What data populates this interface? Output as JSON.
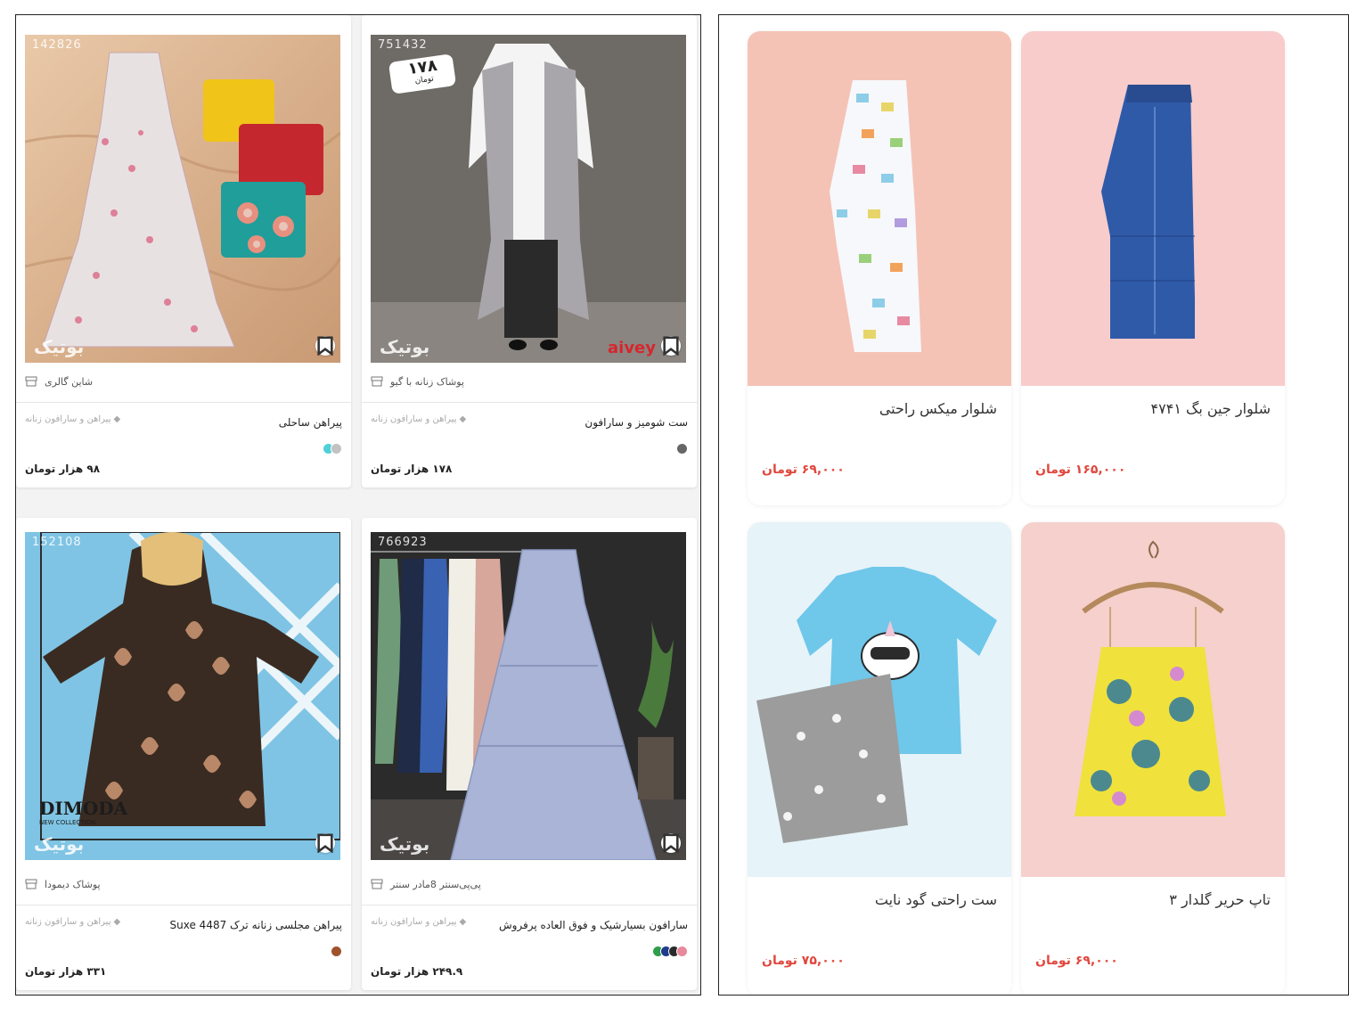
{
  "left_grid": {
    "cards": [
      {
        "code": "142826",
        "watermark": "بوتیک",
        "shop": "شاین گالری",
        "title": "پیراهن ساحلی",
        "category": "پیراهن و سارافون زنانه",
        "price": "۹۸ هزار تومان",
        "colors": [
          "#4fd0d8",
          "#c2c2c2"
        ]
      },
      {
        "code": "751432",
        "badge_price": "۱۷۸",
        "badge_unit": "تومان",
        "watermark": "بوتیک",
        "brand_logo": "aivey",
        "shop": "پوشاک زنانه با گیو",
        "title": "ست شومیز و سارافون",
        "category": "پیراهن و سارافون زنانه",
        "price": "۱۷۸ هزار تومان",
        "colors": [
          "#666666"
        ]
      },
      {
        "code": "152108",
        "watermark": "بوتیک",
        "brand_logo": "DIMODA",
        "brand_sub": "NEW COLLECTION",
        "shop": "پوشاک دیمودا",
        "title": "پیراهن مجلسی زنانه ترک Suxe 4487",
        "category": "پیراهن و سارافون زنانه",
        "price": "۳۳۱ هزار تومان",
        "colors": [
          "#a0522d"
        ]
      },
      {
        "code": "766923",
        "watermark": "بوتیک",
        "shop": "پی‌پی‌سنتر 8مادر سنتر",
        "title": "سارافون بسیارشیک و فوق العاده پرفروش",
        "category": "پیراهن و سارافون زنانه",
        "price": "۲۴۹.۹ هزار تومان",
        "colors": [
          "#2e9e4a",
          "#1f3b8c",
          "#2a2a2a",
          "#e8889a"
        ]
      }
    ]
  },
  "right_grid": {
    "cards": [
      {
        "title": "شلوار جین بگ ۴۷۴۱",
        "price": "۱۶۵,۰۰۰ تومان",
        "bg": "#f8cccb"
      },
      {
        "title": "شلوار میکس راحتی",
        "price": "۶۹,۰۰۰ تومان",
        "bg": "#f4c3b6"
      },
      {
        "title": "تاپ حریر گلدار ۳",
        "price": "۶۹,۰۰۰ تومان",
        "bg": "#f5d0cc"
      },
      {
        "title": "ست راحتی گود نایت",
        "price": "۷۵,۰۰۰ تومان",
        "bg": "#e6f3f8"
      }
    ]
  }
}
